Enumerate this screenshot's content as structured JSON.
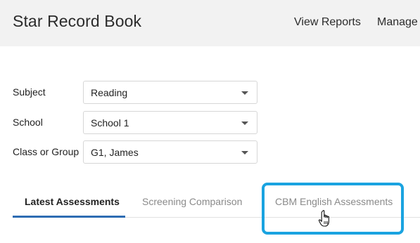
{
  "header": {
    "title": "Star Record Book",
    "nav": {
      "reports_label": "View Reports",
      "manage_label": "Manage"
    }
  },
  "filters": [
    {
      "label": "Subject",
      "value": "Reading"
    },
    {
      "label": "School",
      "value": "School 1"
    },
    {
      "label": "Class or Group",
      "value": "G1, James"
    }
  ],
  "tabs": [
    {
      "label": "Latest Assessments",
      "active": true
    },
    {
      "label": "Screening Comparison",
      "active": false
    },
    {
      "label": "CBM English Assessments",
      "active": false
    }
  ],
  "colors": {
    "header_bg": "#f2f2f2",
    "active_tab_underline": "#2d6cb3",
    "highlight_border": "#1aa3e0",
    "inactive_tab_text": "#8a8a8a"
  },
  "icons": {
    "select_caret": "caret-down-icon",
    "pointer": "hand-pointer-cursor-icon"
  }
}
